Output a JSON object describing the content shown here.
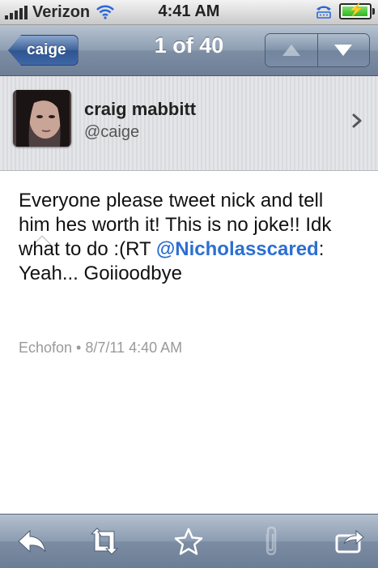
{
  "status": {
    "carrier": "Verizon",
    "time": "4:41 AM",
    "battery_level": 0.85
  },
  "nav": {
    "back_label": "caige",
    "title": "1 of 40"
  },
  "profile": {
    "name": "craig mabbitt",
    "handle": "@caige"
  },
  "tweet": {
    "text_before": "Everyone please tweet nick and tell him hes worth it! This is no joke!! Idk what to do :(RT ",
    "mention": "@Nicholasscared",
    "text_after": ": Yeah... Goiioodbye",
    "meta": "Echofon • 8/7/11 4:40 AM"
  },
  "toolbar": {
    "icons": [
      "reply-icon",
      "retweet-icon",
      "favorite-star-icon",
      "attachment-icon",
      "share-icon"
    ]
  },
  "colors": {
    "mention": "#2c6fd1",
    "nav_button": "#3d67a6",
    "meta": "#9a9a9a"
  }
}
